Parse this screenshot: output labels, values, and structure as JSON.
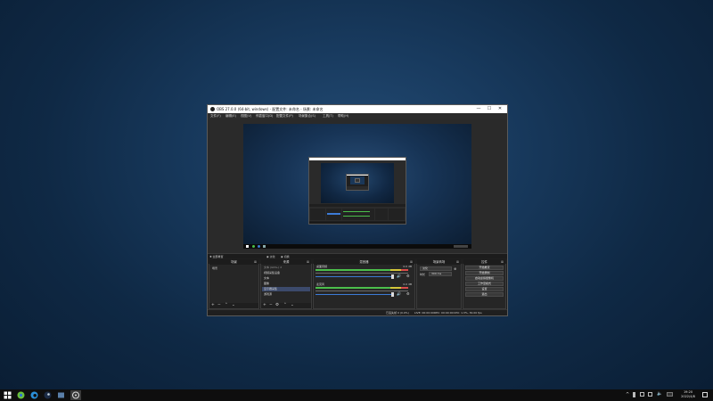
{
  "window": {
    "title": "OBS 27.0.0 (64-bit, windows) - 配置文件: 未命名 - 场景: 未命名",
    "controls": {
      "minimize": "—",
      "maximize": "☐",
      "close": "✕"
    }
  },
  "menu": [
    "文件(F)",
    "编辑(E)",
    "视图(V)",
    "停靠窗口(D)",
    "配置文件(P)",
    "场景集合(S)",
    "工具(T)",
    "帮助(H)"
  ],
  "transition_bar": {
    "left": "✚ 全部重置",
    "mode_a": "◉ 淡化",
    "mode_b": "◉ 切换"
  },
  "docks": {
    "scenes": {
      "title": "场景",
      "items": [
        "场景"
      ]
    },
    "sources": {
      "title": "来源",
      "items": [
        "文本 (GDI+) 2",
        "视频采集设备",
        "文本",
        "图像",
        "显示器采集",
        "游戏源"
      ]
    },
    "mixer": {
      "title": "混音器",
      "channels": [
        {
          "name": "桌面音频",
          "db": "0.0 dB"
        },
        {
          "name": "麦克风",
          "db": "0.0 dB"
        }
      ]
    },
    "transitions": {
      "title": "场景转场",
      "type": "淡化",
      "duration_label": "时长",
      "duration": "300 ms"
    },
    "controls": {
      "title": "控件",
      "buttons": [
        "开始推流",
        "开始录制",
        "启动虚拟摄像机",
        "工作室模式",
        "设置",
        "退出"
      ]
    }
  },
  "statusbar": {
    "dropped": "已丢失帧 0 (0.0%)",
    "live": "LIVE: 00:00:00",
    "rec": "REC: 00:00:00",
    "cpu": "CPU: 1.3%, 30.00 fps"
  },
  "taskbar": {
    "time": "19:20",
    "date": "2022/4/8"
  },
  "colors": {
    "accent": "#3c7bd6",
    "meter_green": "#4bbf4b",
    "meter_yellow": "#d4c63a",
    "meter_red": "#d94b4b"
  }
}
